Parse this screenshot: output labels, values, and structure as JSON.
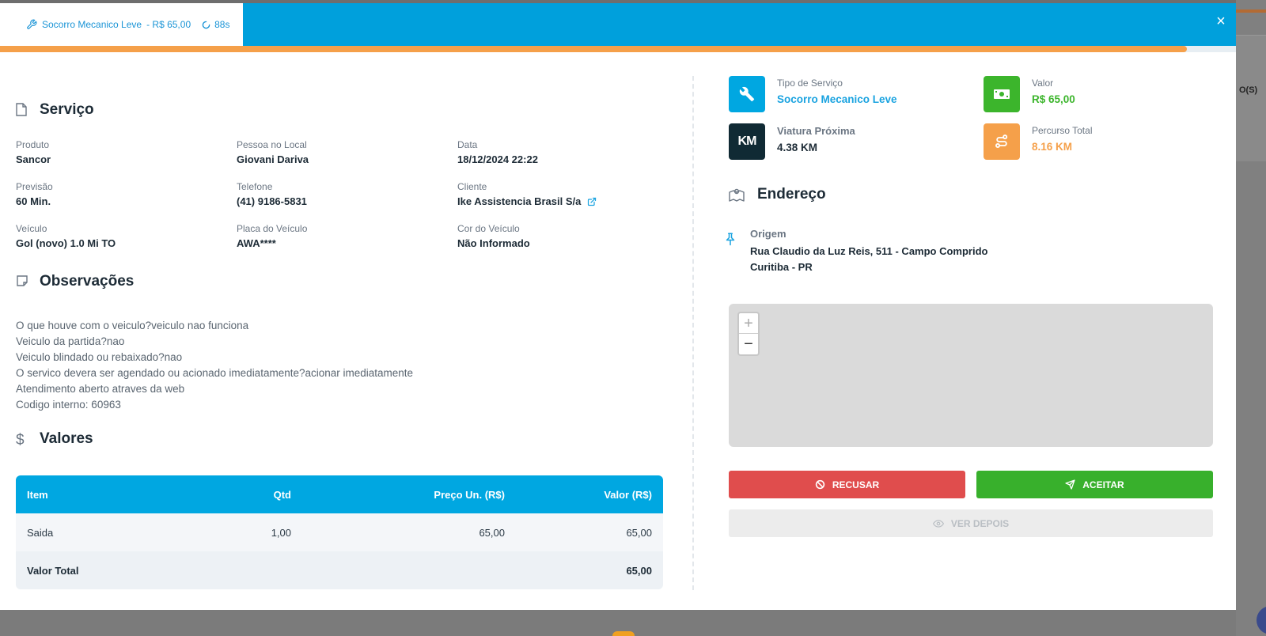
{
  "header": {
    "service_name": "Socorro Mecanico Leve",
    "price": "- R$ 65,00",
    "timer": "88s",
    "close_label": "×",
    "progress_fraction": 0.96
  },
  "servico": {
    "title": "Serviço",
    "fields": [
      {
        "label": "Produto",
        "value": "Sancor"
      },
      {
        "label": "Pessoa no Local",
        "value": "Giovani Dariva"
      },
      {
        "label": "Data",
        "value": "18/12/2024 22:22"
      },
      {
        "label": "Previsão",
        "value": "60 Min."
      },
      {
        "label": "Telefone",
        "value": "(41) 9186-5831"
      },
      {
        "label": "Cliente",
        "value": "Ike Assistencia Brasil S/a"
      },
      {
        "label": "Veículo",
        "value": "Gol (novo) 1.0 Mi TO"
      },
      {
        "label": "Placa do Veículo",
        "value": "AWA****"
      },
      {
        "label": "Cor do Veículo",
        "value": "Não Informado"
      }
    ]
  },
  "observacoes": {
    "title": "Observações",
    "lines": [
      "O que houve com o veiculo?veiculo nao funciona",
      "Veiculo da partida?nao",
      "Veiculo blindado ou rebaixado?nao",
      "O servico devera ser agendado ou acionado imediatamente?acionar imediatamente",
      "Atendimento aberto atraves da web",
      "Codigo interno: 60963"
    ]
  },
  "valores": {
    "title": "Valores",
    "columns": [
      "Item",
      "Qtd",
      "Preço Un. (R$)",
      "Valor (R$)"
    ],
    "rows": [
      [
        "Saida",
        "1,00",
        "65,00",
        "65,00"
      ]
    ],
    "total_label": "Valor Total",
    "total_value": "65,00"
  },
  "cards": {
    "tipo": {
      "label": "Tipo de Serviço",
      "value": "Socorro Mecanico Leve",
      "color": "#1aa3e0",
      "icon": "wrench-icon"
    },
    "valor": {
      "label": "Valor",
      "value": "R$ 65,00",
      "color": "#3cb52c",
      "icon": "money-icon"
    },
    "viatura": {
      "label": "Viatura Próxima",
      "value": "4.38 KM",
      "icon_text": "KM",
      "color": "#102a34"
    },
    "percurso": {
      "label": "Percurso Total",
      "value": "8.16 KM",
      "color": "#f5a04a",
      "icon": "route-icon"
    }
  },
  "endereco": {
    "title": "Endereço",
    "origem_label": "Origem",
    "line1": "Rua Claudio da Luz Reis, 511 - Campo Comprido",
    "line2": "Curitiba - PR"
  },
  "map": {
    "zoom_in": "+",
    "zoom_out": "−"
  },
  "actions": {
    "recusar": "RECUSAR",
    "aceitar": "ACEITAR",
    "ver_depois": "VER DEPOIS"
  },
  "background": {
    "partial_text": "O(S)"
  }
}
